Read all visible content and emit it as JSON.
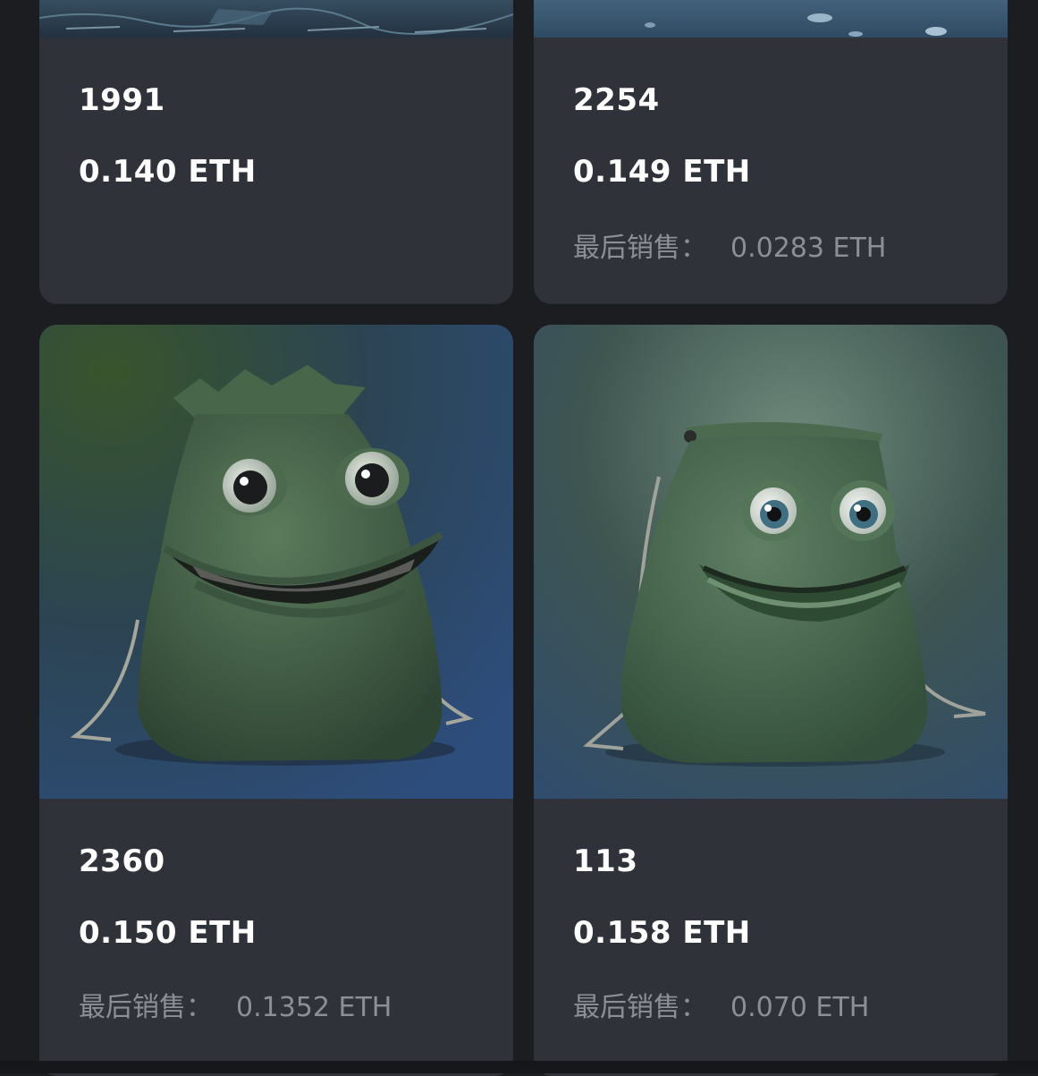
{
  "cards": [
    {
      "name": "1991",
      "price": "0.140 ETH",
      "last_sale_label": "",
      "last_sale_value": ""
    },
    {
      "name": "2254",
      "price": "0.149 ETH",
      "last_sale_label": "最后销售：",
      "last_sale_value": "0.0283 ETH"
    },
    {
      "name": "2360",
      "price": "0.150 ETH",
      "last_sale_label": "最后销售：",
      "last_sale_value": "0.1352 ETH"
    },
    {
      "name": "113",
      "price": "0.158 ETH",
      "last_sale_label": "最后销售：",
      "last_sale_value": "0.070 ETH"
    }
  ],
  "colors": {
    "page_bg": "#1c1d21",
    "card_bg": "#30323a",
    "text_primary": "#ffffff",
    "text_muted": "#8d8f97"
  }
}
